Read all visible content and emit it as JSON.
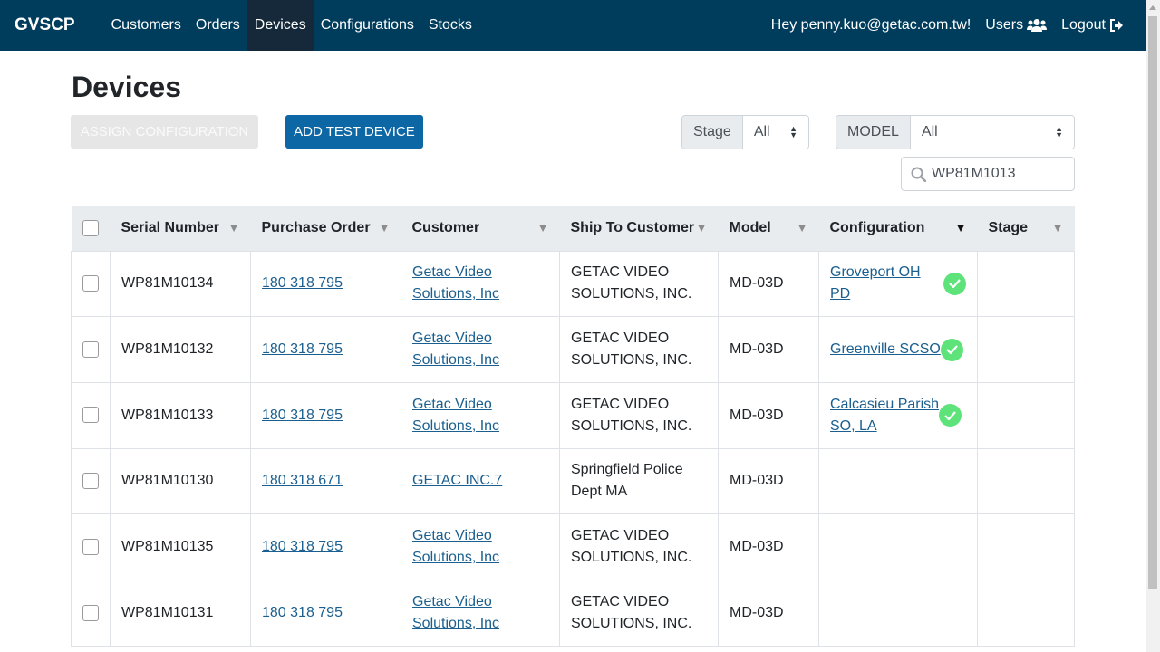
{
  "nav": {
    "brand": "GVSCP",
    "links": [
      "Customers",
      "Orders",
      "Devices",
      "Configurations",
      "Stocks"
    ],
    "active": "Devices",
    "greeting": "Hey penny.kuo@getac.com.tw!",
    "users_label": "Users",
    "logout_label": "Logout"
  },
  "page": {
    "title": "Devices",
    "assign_button": "ASSIGN CONFIGURATION",
    "add_button": "ADD TEST DEVICE",
    "stage_filter": {
      "label": "Stage",
      "value": "All"
    },
    "model_filter": {
      "label": "MODEL",
      "value": "All"
    },
    "search": {
      "value": "WP81M1013",
      "placeholder": ""
    }
  },
  "table": {
    "columns": [
      "Serial Number",
      "Purchase Order",
      "Customer",
      "Ship To Customer",
      "Model",
      "Configuration",
      "Stage"
    ],
    "rows": [
      {
        "serial": "WP81M10134",
        "po": "180 318 795",
        "customer_1": "Getac Video",
        "customer_2": "Solutions, Inc",
        "ship_1": "GETAC VIDEO",
        "ship_2": "SOLUTIONS, INC.",
        "model": "MD-03D",
        "config_1": "Groveport OH PD",
        "config_2": "",
        "status": "ok",
        "stage": ""
      },
      {
        "serial": "WP81M10132",
        "po": "180 318 795",
        "customer_1": "Getac Video",
        "customer_2": "Solutions, Inc",
        "ship_1": "GETAC VIDEO",
        "ship_2": "SOLUTIONS, INC.",
        "model": "MD-03D",
        "config_1": "Greenville SCSO",
        "config_2": "",
        "status": "ok",
        "stage": ""
      },
      {
        "serial": "WP81M10133",
        "po": "180 318 795",
        "customer_1": "Getac Video",
        "customer_2": "Solutions, Inc",
        "ship_1": "GETAC VIDEO",
        "ship_2": "SOLUTIONS, INC.",
        "model": "MD-03D",
        "config_1": "Calcasieu Parish",
        "config_2": "SO, LA",
        "status": "ok",
        "stage": ""
      },
      {
        "serial": "WP81M10130",
        "po": "180 318 671",
        "customer_1": "GETAC INC.7",
        "customer_2": "",
        "ship_1": "Springfield Police",
        "ship_2": "Dept MA",
        "model": "MD-03D",
        "config_1": "",
        "config_2": "",
        "status": "",
        "stage": ""
      },
      {
        "serial": "WP81M10135",
        "po": "180 318 795",
        "customer_1": "Getac Video",
        "customer_2": "Solutions, Inc",
        "ship_1": "GETAC VIDEO",
        "ship_2": "SOLUTIONS, INC.",
        "model": "MD-03D",
        "config_1": "",
        "config_2": "",
        "status": "",
        "stage": ""
      },
      {
        "serial": "WP81M10131",
        "po": "180 318 795",
        "customer_1": "Getac Video",
        "customer_2": "Solutions, Inc",
        "ship_1": "GETAC VIDEO",
        "ship_2": "SOLUTIONS, INC.",
        "model": "MD-03D",
        "config_1": "",
        "config_2": "",
        "status": "",
        "stage": ""
      }
    ]
  },
  "colors": {
    "navbar": "#003d5c",
    "primary_button": "#0d67a5",
    "ok": "#5ee37a",
    "link": "#1a5f8f"
  }
}
